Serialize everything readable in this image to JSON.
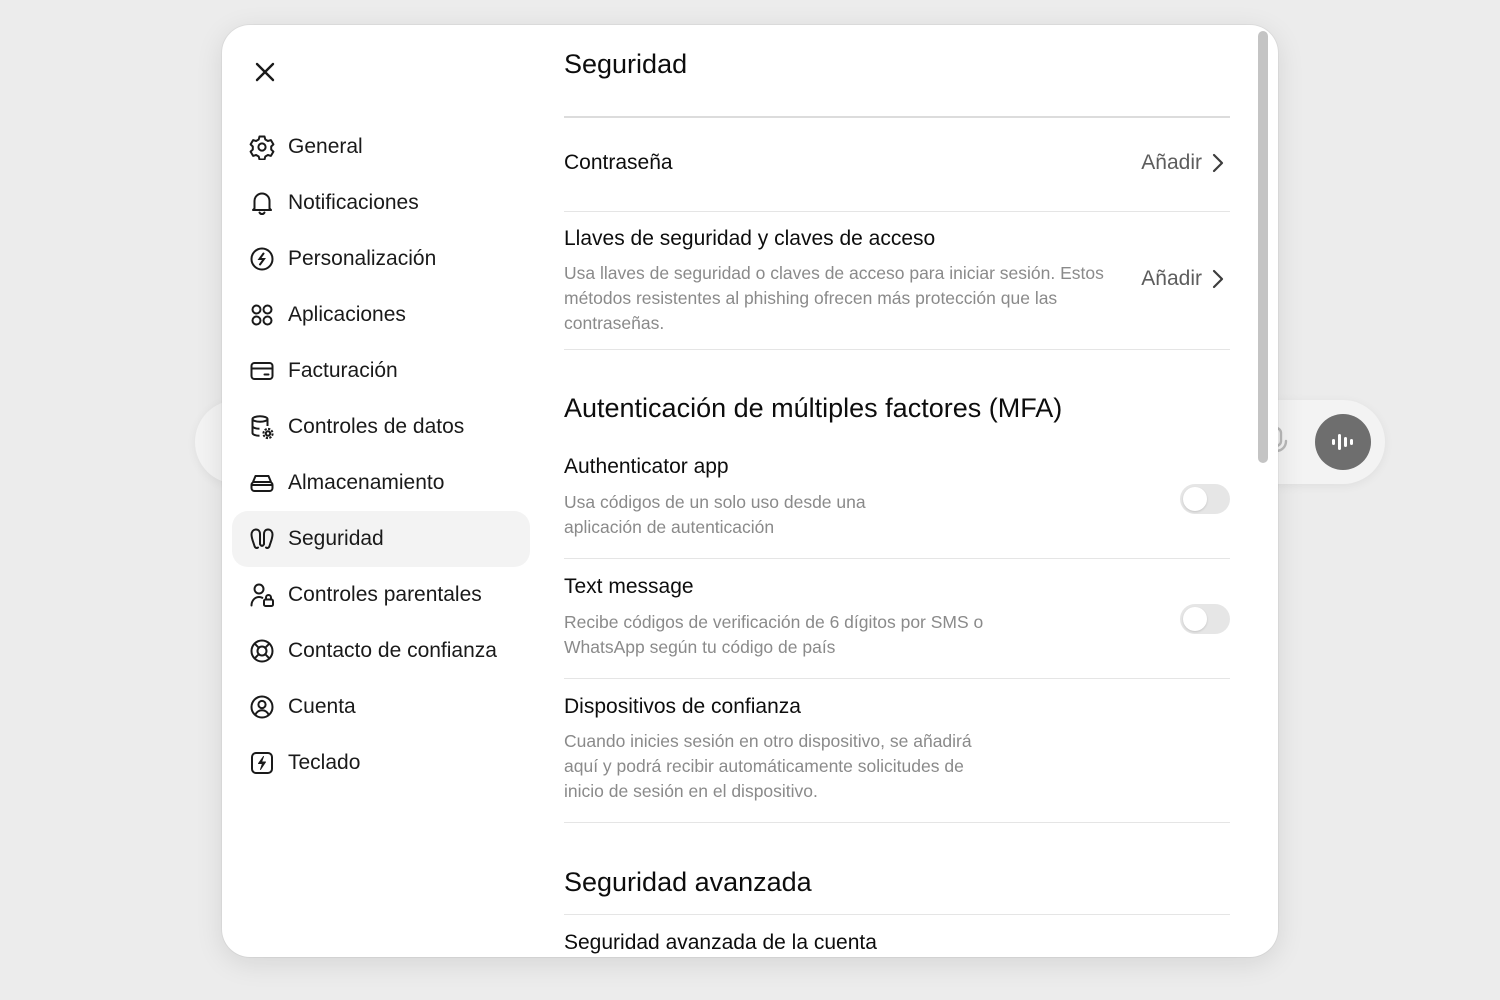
{
  "colors": {
    "background": "#ececec",
    "modal": "#ffffff",
    "active_item": "#f3f3f3",
    "muted_text": "#8a8a8a",
    "toggle_off": "#e6e6e6"
  },
  "modal": {
    "close_icon": "close-icon"
  },
  "sidebar": {
    "items": [
      {
        "label": "General",
        "icon": "gear-icon",
        "active": false
      },
      {
        "label": "Notificaciones",
        "icon": "bell-icon",
        "active": false
      },
      {
        "label": "Personalización",
        "icon": "personalization-icon",
        "active": false
      },
      {
        "label": "Aplicaciones",
        "icon": "apps-grid-icon",
        "active": false
      },
      {
        "label": "Facturación",
        "icon": "credit-card-icon",
        "active": false
      },
      {
        "label": "Controles de datos",
        "icon": "database-gear-icon",
        "active": false
      },
      {
        "label": "Almacenamiento",
        "icon": "storage-drive-icon",
        "active": false
      },
      {
        "label": "Seguridad",
        "icon": "security-icon",
        "active": true
      },
      {
        "label": "Controles parentales",
        "icon": "parental-lock-icon",
        "active": false
      },
      {
        "label": "Contacto de confianza",
        "icon": "lifebuoy-icon",
        "active": false
      },
      {
        "label": "Cuenta",
        "icon": "user-circle-icon",
        "active": false
      },
      {
        "label": "Teclado",
        "icon": "keyboard-bolt-icon",
        "active": false
      }
    ]
  },
  "main": {
    "title": "Seguridad",
    "password": {
      "title": "Contraseña",
      "action": "Añadir"
    },
    "passkeys": {
      "title": "Llaves de seguridad y claves de acceso",
      "description": "Usa llaves de seguridad o claves de acceso para iniciar sesión. Estos métodos resistentes al phishing ofrecen más protección que las contraseñas.",
      "action": "Añadir"
    },
    "mfa": {
      "section_title": "Autenticación de múltiples factores (MFA)",
      "authenticator": {
        "title": "Authenticator app",
        "description": "Usa códigos de un solo uso desde una aplicación de autenticación",
        "enabled": false
      },
      "sms": {
        "title": "Text message",
        "description": "Recibe códigos de verificación de 6 dígitos por SMS o WhatsApp según tu código de país",
        "enabled": false
      },
      "trusted_devices": {
        "title": "Dispositivos de confianza",
        "description": "Cuando inicies sesión en otro dispositivo, se añadirá aquí y podrá recibir automáticamente solicitudes de inicio de sesión en el dispositivo."
      }
    },
    "advanced": {
      "section_title": "Seguridad avanzada",
      "account_row_title": "Seguridad avanzada de la cuenta"
    }
  }
}
